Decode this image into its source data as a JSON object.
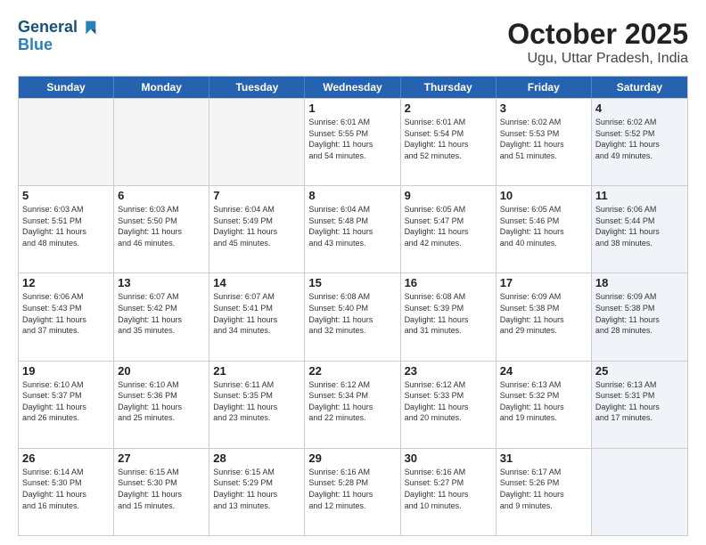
{
  "header": {
    "logo_line1": "General",
    "logo_line2": "Blue",
    "title": "October 2025",
    "subtitle": "Ugu, Uttar Pradesh, India"
  },
  "weekdays": [
    "Sunday",
    "Monday",
    "Tuesday",
    "Wednesday",
    "Thursday",
    "Friday",
    "Saturday"
  ],
  "weeks": [
    [
      {
        "day": "",
        "info": "",
        "empty": true
      },
      {
        "day": "",
        "info": "",
        "empty": true
      },
      {
        "day": "",
        "info": "",
        "empty": true
      },
      {
        "day": "1",
        "info": "Sunrise: 6:01 AM\nSunset: 5:55 PM\nDaylight: 11 hours\nand 54 minutes.",
        "empty": false
      },
      {
        "day": "2",
        "info": "Sunrise: 6:01 AM\nSunset: 5:54 PM\nDaylight: 11 hours\nand 52 minutes.",
        "empty": false
      },
      {
        "day": "3",
        "info": "Sunrise: 6:02 AM\nSunset: 5:53 PM\nDaylight: 11 hours\nand 51 minutes.",
        "empty": false
      },
      {
        "day": "4",
        "info": "Sunrise: 6:02 AM\nSunset: 5:52 PM\nDaylight: 11 hours\nand 49 minutes.",
        "empty": false,
        "shaded": true
      }
    ],
    [
      {
        "day": "5",
        "info": "Sunrise: 6:03 AM\nSunset: 5:51 PM\nDaylight: 11 hours\nand 48 minutes.",
        "empty": false
      },
      {
        "day": "6",
        "info": "Sunrise: 6:03 AM\nSunset: 5:50 PM\nDaylight: 11 hours\nand 46 minutes.",
        "empty": false
      },
      {
        "day": "7",
        "info": "Sunrise: 6:04 AM\nSunset: 5:49 PM\nDaylight: 11 hours\nand 45 minutes.",
        "empty": false
      },
      {
        "day": "8",
        "info": "Sunrise: 6:04 AM\nSunset: 5:48 PM\nDaylight: 11 hours\nand 43 minutes.",
        "empty": false
      },
      {
        "day": "9",
        "info": "Sunrise: 6:05 AM\nSunset: 5:47 PM\nDaylight: 11 hours\nand 42 minutes.",
        "empty": false
      },
      {
        "day": "10",
        "info": "Sunrise: 6:05 AM\nSunset: 5:46 PM\nDaylight: 11 hours\nand 40 minutes.",
        "empty": false
      },
      {
        "day": "11",
        "info": "Sunrise: 6:06 AM\nSunset: 5:44 PM\nDaylight: 11 hours\nand 38 minutes.",
        "empty": false,
        "shaded": true
      }
    ],
    [
      {
        "day": "12",
        "info": "Sunrise: 6:06 AM\nSunset: 5:43 PM\nDaylight: 11 hours\nand 37 minutes.",
        "empty": false
      },
      {
        "day": "13",
        "info": "Sunrise: 6:07 AM\nSunset: 5:42 PM\nDaylight: 11 hours\nand 35 minutes.",
        "empty": false
      },
      {
        "day": "14",
        "info": "Sunrise: 6:07 AM\nSunset: 5:41 PM\nDaylight: 11 hours\nand 34 minutes.",
        "empty": false
      },
      {
        "day": "15",
        "info": "Sunrise: 6:08 AM\nSunset: 5:40 PM\nDaylight: 11 hours\nand 32 minutes.",
        "empty": false
      },
      {
        "day": "16",
        "info": "Sunrise: 6:08 AM\nSunset: 5:39 PM\nDaylight: 11 hours\nand 31 minutes.",
        "empty": false
      },
      {
        "day": "17",
        "info": "Sunrise: 6:09 AM\nSunset: 5:38 PM\nDaylight: 11 hours\nand 29 minutes.",
        "empty": false
      },
      {
        "day": "18",
        "info": "Sunrise: 6:09 AM\nSunset: 5:38 PM\nDaylight: 11 hours\nand 28 minutes.",
        "empty": false,
        "shaded": true
      }
    ],
    [
      {
        "day": "19",
        "info": "Sunrise: 6:10 AM\nSunset: 5:37 PM\nDaylight: 11 hours\nand 26 minutes.",
        "empty": false
      },
      {
        "day": "20",
        "info": "Sunrise: 6:10 AM\nSunset: 5:36 PM\nDaylight: 11 hours\nand 25 minutes.",
        "empty": false
      },
      {
        "day": "21",
        "info": "Sunrise: 6:11 AM\nSunset: 5:35 PM\nDaylight: 11 hours\nand 23 minutes.",
        "empty": false
      },
      {
        "day": "22",
        "info": "Sunrise: 6:12 AM\nSunset: 5:34 PM\nDaylight: 11 hours\nand 22 minutes.",
        "empty": false
      },
      {
        "day": "23",
        "info": "Sunrise: 6:12 AM\nSunset: 5:33 PM\nDaylight: 11 hours\nand 20 minutes.",
        "empty": false
      },
      {
        "day": "24",
        "info": "Sunrise: 6:13 AM\nSunset: 5:32 PM\nDaylight: 11 hours\nand 19 minutes.",
        "empty": false
      },
      {
        "day": "25",
        "info": "Sunrise: 6:13 AM\nSunset: 5:31 PM\nDaylight: 11 hours\nand 17 minutes.",
        "empty": false,
        "shaded": true
      }
    ],
    [
      {
        "day": "26",
        "info": "Sunrise: 6:14 AM\nSunset: 5:30 PM\nDaylight: 11 hours\nand 16 minutes.",
        "empty": false
      },
      {
        "day": "27",
        "info": "Sunrise: 6:15 AM\nSunset: 5:30 PM\nDaylight: 11 hours\nand 15 minutes.",
        "empty": false
      },
      {
        "day": "28",
        "info": "Sunrise: 6:15 AM\nSunset: 5:29 PM\nDaylight: 11 hours\nand 13 minutes.",
        "empty": false
      },
      {
        "day": "29",
        "info": "Sunrise: 6:16 AM\nSunset: 5:28 PM\nDaylight: 11 hours\nand 12 minutes.",
        "empty": false
      },
      {
        "day": "30",
        "info": "Sunrise: 6:16 AM\nSunset: 5:27 PM\nDaylight: 11 hours\nand 10 minutes.",
        "empty": false
      },
      {
        "day": "31",
        "info": "Sunrise: 6:17 AM\nSunset: 5:26 PM\nDaylight: 11 hours\nand 9 minutes.",
        "empty": false
      },
      {
        "day": "",
        "info": "",
        "empty": true,
        "shaded": true
      }
    ]
  ]
}
